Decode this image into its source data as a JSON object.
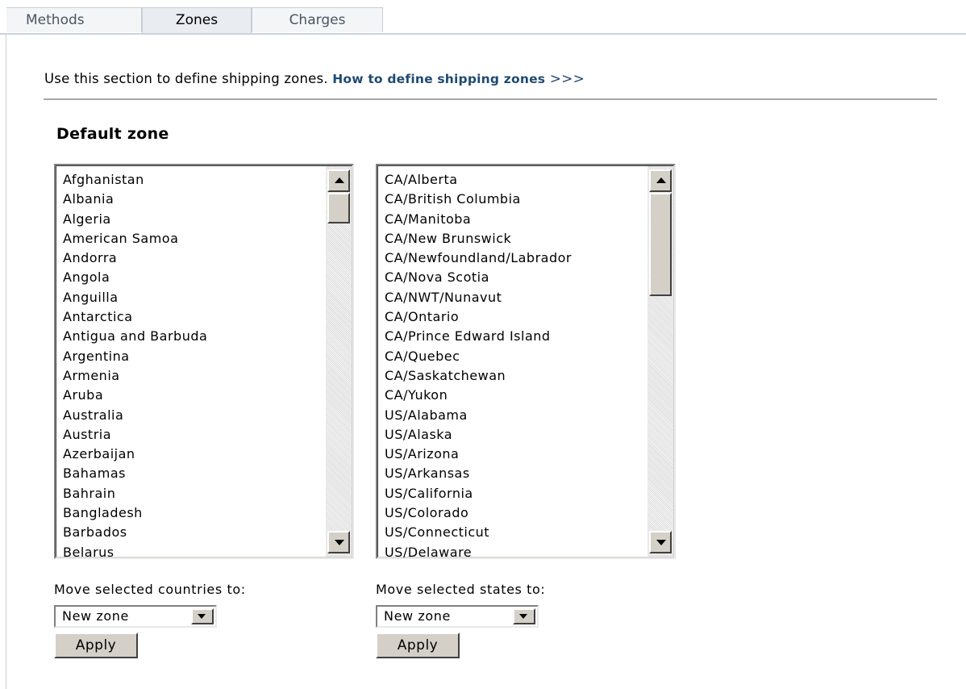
{
  "tabs": [
    {
      "label": "Methods",
      "active": false
    },
    {
      "label": "Zones",
      "active": true
    },
    {
      "label": "Charges",
      "active": false
    }
  ],
  "intro": {
    "text": "Use this section to define shipping zones.",
    "link_label": "How to define shipping zones",
    "link_arrows": ">>>"
  },
  "zone_title": "Default zone",
  "countries": [
    "Afghanistan",
    "Albania",
    "Algeria",
    "American Samoa",
    "Andorra",
    "Angola",
    "Anguilla",
    "Antarctica",
    "Antigua and Barbuda",
    "Argentina",
    "Armenia",
    "Aruba",
    "Australia",
    "Austria",
    "Azerbaijan",
    "Bahamas",
    "Bahrain",
    "Bangladesh",
    "Barbados",
    "Belarus"
  ],
  "states": [
    "CA/Alberta",
    "CA/British Columbia",
    "CA/Manitoba",
    "CA/New Brunswick",
    "CA/Newfoundland/Labrador",
    "CA/Nova Scotia",
    "CA/NWT/Nunavut",
    "CA/Ontario",
    "CA/Prince Edward Island",
    "CA/Quebec",
    "CA/Saskatchewan",
    "CA/Yukon",
    "US/Alabama",
    "US/Alaska",
    "US/Arizona",
    "US/Arkansas",
    "US/California",
    "US/Colorado",
    "US/Connecticut",
    "US/Delaware"
  ],
  "countries_controls": {
    "move_label": "Move selected countries to:",
    "selected": "New zone",
    "apply_label": "Apply"
  },
  "states_controls": {
    "move_label": "Move selected states to:",
    "selected": "New zone",
    "apply_label": "Apply"
  }
}
